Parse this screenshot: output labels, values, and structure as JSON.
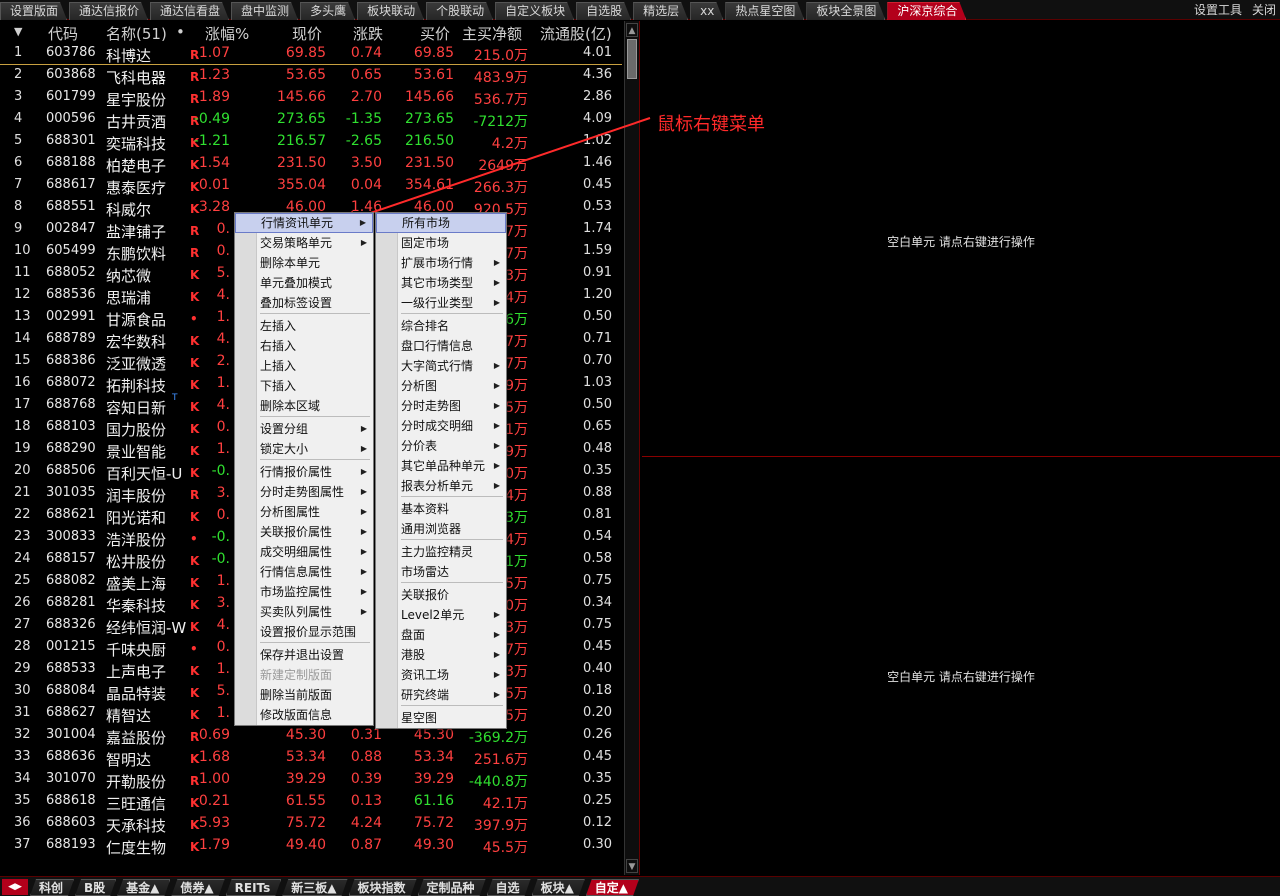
{
  "tabs": [
    {
      "label": "设置版面",
      "active": false
    },
    {
      "label": "通达信报价",
      "active": false
    },
    {
      "label": "通达信看盘",
      "active": false
    },
    {
      "label": "盘中监测",
      "active": false
    },
    {
      "label": "多头鹰",
      "active": false
    },
    {
      "label": "板块联动",
      "active": false
    },
    {
      "label": "个股联动",
      "active": false
    },
    {
      "label": "自定义板块",
      "active": false
    },
    {
      "label": "自选股",
      "active": false
    },
    {
      "label": "精选层",
      "active": false
    },
    {
      "label": "xx",
      "active": false
    },
    {
      "label": "热点星空图",
      "active": false
    },
    {
      "label": "板块全景图",
      "active": false
    },
    {
      "label": "沪深京综合",
      "active": true
    }
  ],
  "topright": {
    "tools": "设置工具",
    "close": "关闭"
  },
  "table": {
    "headers": {
      "sort": "▼",
      "code": "代码",
      "name": "名称(51)",
      "dot": "•",
      "pct": "涨幅%",
      "price": "现价",
      "chg": "涨跌",
      "bid": "买价",
      "net": "主买净额",
      "float": "流通股(亿)"
    },
    "rows": [
      {
        "idx": "1",
        "code": "603786",
        "name": "科博达",
        "tag": "R",
        "pct": "1.07",
        "price": "69.85",
        "chg": "0.74",
        "bid": "69.85",
        "net": "215.0万",
        "float": "4.01",
        "dir": "up",
        "net_dir": "up"
      },
      {
        "idx": "2",
        "code": "603868",
        "name": "飞科电器",
        "tag": "R",
        "pct": "1.23",
        "price": "53.65",
        "chg": "0.65",
        "bid": "53.61",
        "net": "483.9万",
        "float": "4.36",
        "dir": "up",
        "net_dir": "up"
      },
      {
        "idx": "3",
        "code": "601799",
        "name": "星宇股份",
        "tag": "R",
        "pct": "1.89",
        "price": "145.66",
        "chg": "2.70",
        "bid": "145.66",
        "net": "536.7万",
        "float": "2.86",
        "dir": "up",
        "net_dir": "up"
      },
      {
        "idx": "4",
        "code": "000596",
        "name": "古井贡酒",
        "tag": "R",
        "pct": "-0.49",
        "price": "273.65",
        "chg": "-1.35",
        "bid": "273.65",
        "net": "-7212万",
        "float": "4.09",
        "dir": "down",
        "net_dir": "down"
      },
      {
        "idx": "5",
        "code": "688301",
        "name": "奕瑞科技",
        "tag": "K",
        "pct": "-1.21",
        "price": "216.57",
        "chg": "-2.65",
        "bid": "216.50",
        "net": "4.2万",
        "float": "1.02",
        "dir": "down",
        "net_dir": "up"
      },
      {
        "idx": "6",
        "code": "688188",
        "name": "柏楚电子",
        "tag": "K",
        "pct": "1.54",
        "price": "231.50",
        "chg": "3.50",
        "bid": "231.50",
        "net": "2649万",
        "float": "1.46",
        "dir": "up",
        "net_dir": "up"
      },
      {
        "idx": "7",
        "code": "688617",
        "name": "惠泰医疗",
        "tag": "K",
        "pct": "0.01",
        "price": "355.04",
        "chg": "0.04",
        "bid": "354.61",
        "net": "266.3万",
        "float": "0.45",
        "dir": "up",
        "net_dir": "up"
      },
      {
        "idx": "8",
        "code": "688551",
        "name": "科威尔",
        "tag": "K",
        "pct": "3.28",
        "price": "46.00",
        "chg": "1.46",
        "bid": "46.00",
        "net": "920.5万",
        "float": "0.53",
        "dir": "up",
        "net_dir": "up"
      },
      {
        "idx": "9",
        "code": "002847",
        "name": "盐津铺子",
        "tag": "R",
        "pct": "0.",
        "price": "",
        "chg": "",
        "bid": "",
        "net": "7万",
        "float": "1.74",
        "dir": "up",
        "net_dir": "up"
      },
      {
        "idx": "10",
        "code": "605499",
        "name": "东鹏饮料",
        "tag": "R",
        "pct": "0.",
        "price": "",
        "chg": "",
        "bid": "",
        "net": "7万",
        "float": "1.59",
        "dir": "up",
        "net_dir": "up"
      },
      {
        "idx": "11",
        "code": "688052",
        "name": "纳芯微",
        "tag": "K",
        "pct": "5.",
        "price": "",
        "chg": "",
        "bid": "",
        "net": "3万",
        "float": "0.91",
        "dir": "up",
        "net_dir": "up"
      },
      {
        "idx": "12",
        "code": "688536",
        "name": "思瑞浦",
        "tag": "K",
        "pct": "4.",
        "price": "",
        "chg": "",
        "bid": "",
        "net": "4万",
        "float": "1.20",
        "dir": "up",
        "net_dir": "up"
      },
      {
        "idx": "13",
        "code": "002991",
        "name": "甘源食品",
        "tag": "•",
        "pct": "1.",
        "price": "",
        "chg": "",
        "bid": "",
        "net": "6万",
        "float": "0.50",
        "dir": "up",
        "net_dir": "down"
      },
      {
        "idx": "14",
        "code": "688789",
        "name": "宏华数科",
        "tag": "K",
        "pct": "4.",
        "price": "",
        "chg": "",
        "bid": "",
        "net": "7万",
        "float": "0.71",
        "dir": "up",
        "net_dir": "up"
      },
      {
        "idx": "15",
        "code": "688386",
        "name": "泛亚微透",
        "tag": "K",
        "pct": "2.",
        "price": "",
        "chg": "",
        "bid": "",
        "net": "7万",
        "float": "0.70",
        "dir": "up",
        "net_dir": "up"
      },
      {
        "idx": "16",
        "code": "688072",
        "name": "拓荆科技",
        "tag": "K",
        "pct": "1.",
        "price": "",
        "chg": "",
        "bid": "",
        "net": "9万",
        "float": "1.03",
        "dir": "up",
        "net_dir": "up"
      },
      {
        "idx": "17",
        "code": "688768",
        "name": "容知日新",
        "name_sup": "T",
        "tag": "K",
        "pct": "4.",
        "price": "",
        "chg": "",
        "bid": "",
        "net": "5万",
        "float": "0.50",
        "dir": "up",
        "net_dir": "up"
      },
      {
        "idx": "18",
        "code": "688103",
        "name": "国力股份",
        "tag": "K",
        "pct": "0.",
        "price": "",
        "chg": "",
        "bid": "",
        "net": "1万",
        "float": "0.65",
        "dir": "up",
        "net_dir": "up"
      },
      {
        "idx": "19",
        "code": "688290",
        "name": "景业智能",
        "tag": "K",
        "pct": "1.",
        "price": "",
        "chg": "",
        "bid": "",
        "net": "9万",
        "float": "0.48",
        "dir": "up",
        "net_dir": "up"
      },
      {
        "idx": "20",
        "code": "688506",
        "name": "百利天恒-U",
        "tag": "K",
        "pct": "-0.",
        "price": "",
        "chg": "",
        "bid": "",
        "net": "0万",
        "float": "0.35",
        "dir": "down",
        "net_dir": "up"
      },
      {
        "idx": "21",
        "code": "301035",
        "name": "润丰股份",
        "tag": "R",
        "pct": "3.",
        "price": "",
        "chg": "",
        "bid": "",
        "net": "4万",
        "float": "0.88",
        "dir": "up",
        "net_dir": "up"
      },
      {
        "idx": "22",
        "code": "688621",
        "name": "阳光诺和",
        "tag": "K",
        "pct": "0.",
        "price": "",
        "chg": "",
        "bid": "",
        "net": "3万",
        "float": "0.81",
        "dir": "up",
        "net_dir": "down"
      },
      {
        "idx": "23",
        "code": "300833",
        "name": "浩洋股份",
        "tag": "•",
        "pct": "-0.",
        "price": "",
        "chg": "",
        "bid": "",
        "net": "4万",
        "float": "0.54",
        "dir": "down",
        "net_dir": "up"
      },
      {
        "idx": "24",
        "code": "688157",
        "name": "松井股份",
        "tag": "K",
        "pct": "-0.",
        "price": "",
        "chg": "",
        "bid": "",
        "net": "1万",
        "float": "0.58",
        "dir": "down",
        "net_dir": "down"
      },
      {
        "idx": "25",
        "code": "688082",
        "name": "盛美上海",
        "tag": "K",
        "pct": "1.",
        "price": "",
        "chg": "",
        "bid": "",
        "net": "5万",
        "float": "0.75",
        "dir": "up",
        "net_dir": "up"
      },
      {
        "idx": "26",
        "code": "688281",
        "name": "华秦科技",
        "tag": "K",
        "pct": "3.",
        "price": "",
        "chg": "",
        "bid": "",
        "net": "0万",
        "float": "0.34",
        "dir": "up",
        "net_dir": "up"
      },
      {
        "idx": "27",
        "code": "688326",
        "name": "经纬恒润-W",
        "tag": "K",
        "pct": "4.",
        "price": "",
        "chg": "",
        "bid": "",
        "net": "3万",
        "float": "0.75",
        "dir": "up",
        "net_dir": "up"
      },
      {
        "idx": "28",
        "code": "001215",
        "name": "千味央厨",
        "tag": "•",
        "pct": "0.",
        "price": "",
        "chg": "",
        "bid": "",
        "net": "7万",
        "float": "0.45",
        "dir": "up",
        "net_dir": "up"
      },
      {
        "idx": "29",
        "code": "688533",
        "name": "上声电子",
        "tag": "K",
        "pct": "1.",
        "price": "",
        "chg": "",
        "bid": "",
        "net": "3万",
        "float": "0.40",
        "dir": "up",
        "net_dir": "up"
      },
      {
        "idx": "30",
        "code": "688084",
        "name": "晶品特装",
        "tag": "K",
        "pct": "5.",
        "price": "",
        "chg": "",
        "bid": "",
        "net": "5万",
        "float": "0.18",
        "dir": "up",
        "net_dir": "up"
      },
      {
        "idx": "31",
        "code": "688627",
        "name": "精智达",
        "tag": "K",
        "pct": "1.",
        "price": "",
        "chg": "",
        "bid": "",
        "net": "5万",
        "float": "0.20",
        "dir": "up",
        "net_dir": "up"
      },
      {
        "idx": "32",
        "code": "301004",
        "name": "嘉益股份",
        "tag": "R",
        "pct": "0.69",
        "price": "45.30",
        "chg": "0.31",
        "bid": "45.30",
        "net": "-369.2万",
        "float": "0.26",
        "dir": "up",
        "net_dir": "down"
      },
      {
        "idx": "33",
        "code": "688636",
        "name": "智明达",
        "tag": "K",
        "pct": "1.68",
        "price": "53.34",
        "chg": "0.88",
        "bid": "53.34",
        "net": "251.6万",
        "float": "0.45",
        "dir": "up",
        "net_dir": "up"
      },
      {
        "idx": "34",
        "code": "301070",
        "name": "开勒股份",
        "tag": "R",
        "pct": "1.00",
        "price": "39.29",
        "chg": "0.39",
        "bid": "39.29",
        "net": "-440.8万",
        "float": "0.35",
        "dir": "up",
        "net_dir": "down"
      },
      {
        "idx": "35",
        "code": "688618",
        "name": "三旺通信",
        "tag": "K",
        "pct": "0.21",
        "price": "61.55",
        "chg": "0.13",
        "bid": "61.16",
        "net": "42.1万",
        "float": "0.25",
        "dir": "up",
        "net_dir": "up",
        "bid_dir": "down"
      },
      {
        "idx": "36",
        "code": "688603",
        "name": "天承科技",
        "tag": "K",
        "pct": "5.93",
        "price": "75.72",
        "chg": "4.24",
        "bid": "75.72",
        "net": "397.9万",
        "float": "0.12",
        "dir": "up",
        "net_dir": "up"
      },
      {
        "idx": "37",
        "code": "688193",
        "name": "仁度生物",
        "tag": "K",
        "pct": "1.79",
        "price": "49.40",
        "chg": "0.87",
        "bid": "49.30",
        "net": "45.5万",
        "float": "0.30",
        "dir": "up",
        "net_dir": "up"
      }
    ]
  },
  "right_panels": {
    "top_msg": "空白单元 请点右键进行操作",
    "bottom_msg": "空白单元 请点右键进行操作"
  },
  "annotation": "鼠标右键菜单",
  "menu1": [
    {
      "label": "行情资讯单元",
      "sub": true,
      "hl": true
    },
    {
      "label": "交易策略单元",
      "sub": true
    },
    {
      "label": "删除本单元"
    },
    {
      "label": "单元叠加模式"
    },
    {
      "label": "叠加标签设置"
    },
    {
      "sep": true
    },
    {
      "label": "左插入"
    },
    {
      "label": "右插入"
    },
    {
      "label": "上插入"
    },
    {
      "label": "下插入"
    },
    {
      "label": "删除本区域"
    },
    {
      "sep": true
    },
    {
      "label": "设置分组",
      "sub": true
    },
    {
      "label": "锁定大小",
      "sub": true
    },
    {
      "sep": true
    },
    {
      "label": "行情报价属性",
      "sub": true
    },
    {
      "label": "分时走势图属性",
      "sub": true
    },
    {
      "label": "分析图属性",
      "sub": true
    },
    {
      "label": "关联报价属性",
      "sub": true
    },
    {
      "label": "成交明细属性",
      "sub": true
    },
    {
      "label": "行情信息属性",
      "sub": true
    },
    {
      "label": "市场监控属性",
      "sub": true
    },
    {
      "label": "买卖队列属性",
      "sub": true
    },
    {
      "label": "设置报价显示范围"
    },
    {
      "sep": true
    },
    {
      "label": "保存并退出设置"
    },
    {
      "label": "新建定制版面",
      "disabled": true
    },
    {
      "label": "删除当前版面"
    },
    {
      "label": "修改版面信息"
    }
  ],
  "menu2": [
    {
      "label": "所有市场",
      "hl": true
    },
    {
      "label": "固定市场"
    },
    {
      "label": "扩展市场行情",
      "sub": true
    },
    {
      "label": "其它市场类型",
      "sub": true
    },
    {
      "label": "一级行业类型",
      "sub": true
    },
    {
      "sep": true
    },
    {
      "label": "综合排名"
    },
    {
      "label": "盘口行情信息"
    },
    {
      "label": "大字简式行情",
      "sub": true
    },
    {
      "label": "分析图",
      "sub": true
    },
    {
      "label": "分时走势图",
      "sub": true
    },
    {
      "label": "分时成交明细",
      "sub": true
    },
    {
      "label": "分价表",
      "sub": true
    },
    {
      "label": "其它单品种单元",
      "sub": true
    },
    {
      "label": "报表分析单元",
      "sub": true
    },
    {
      "sep": true
    },
    {
      "label": "基本资料"
    },
    {
      "label": "通用浏览器"
    },
    {
      "sep": true
    },
    {
      "label": "主力监控精灵"
    },
    {
      "label": "市场雷达"
    },
    {
      "sep": true
    },
    {
      "label": "关联报价"
    },
    {
      "label": "Level2单元",
      "sub": true
    },
    {
      "label": "盘面",
      "sub": true
    },
    {
      "label": "港股",
      "sub": true
    },
    {
      "label": "资讯工场",
      "sub": true
    },
    {
      "label": "研究终端",
      "sub": true
    },
    {
      "sep": true
    },
    {
      "label": "星空图"
    }
  ],
  "bottom_tabs": [
    {
      "label": "科创",
      "active": false
    },
    {
      "label": "B股",
      "active": false
    },
    {
      "label": "基金▲",
      "active": false
    },
    {
      "label": "债券▲",
      "active": false
    },
    {
      "label": "REITs",
      "active": false
    },
    {
      "label": "新三板▲",
      "active": false
    },
    {
      "label": "板块指数",
      "active": false
    },
    {
      "label": "定制品种",
      "active": false
    },
    {
      "label": "自选",
      "active": false
    },
    {
      "label": "板块▲",
      "active": false
    },
    {
      "label": "自定▲",
      "active": true
    }
  ],
  "bottom_nav": "◀▶",
  "colors": {
    "up": "#ff4040",
    "down": "#30e030",
    "accent": "#b3001b",
    "annotation": "#ff2a2a"
  }
}
